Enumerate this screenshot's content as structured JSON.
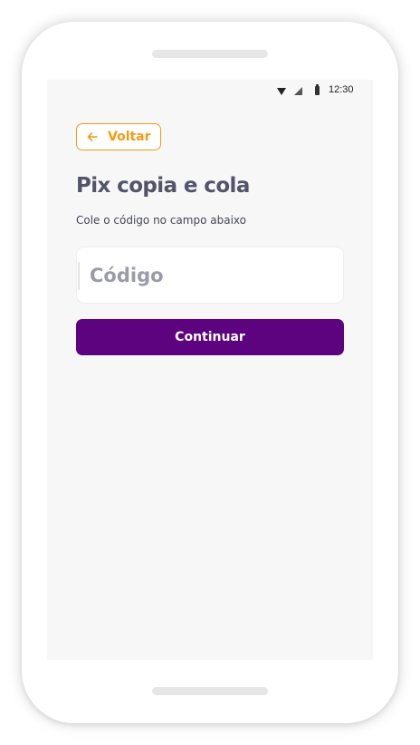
{
  "status_bar": {
    "time": "12:30",
    "icons": [
      "wifi-icon",
      "cell-signal-icon",
      "battery-icon"
    ]
  },
  "header": {
    "back_label": "Voltar",
    "back_icon": "arrow-left-icon"
  },
  "main": {
    "title": "Pix copia e cola",
    "subtitle": "Cole o código no campo abaixo",
    "code_input": {
      "placeholder": "Código",
      "value": ""
    },
    "continue_label": "Continuar"
  },
  "colors": {
    "accent_orange": "#f39c12",
    "primary_purple": "#5d0380",
    "title_color": "#525469",
    "screen_background": "#f7f7f7"
  }
}
